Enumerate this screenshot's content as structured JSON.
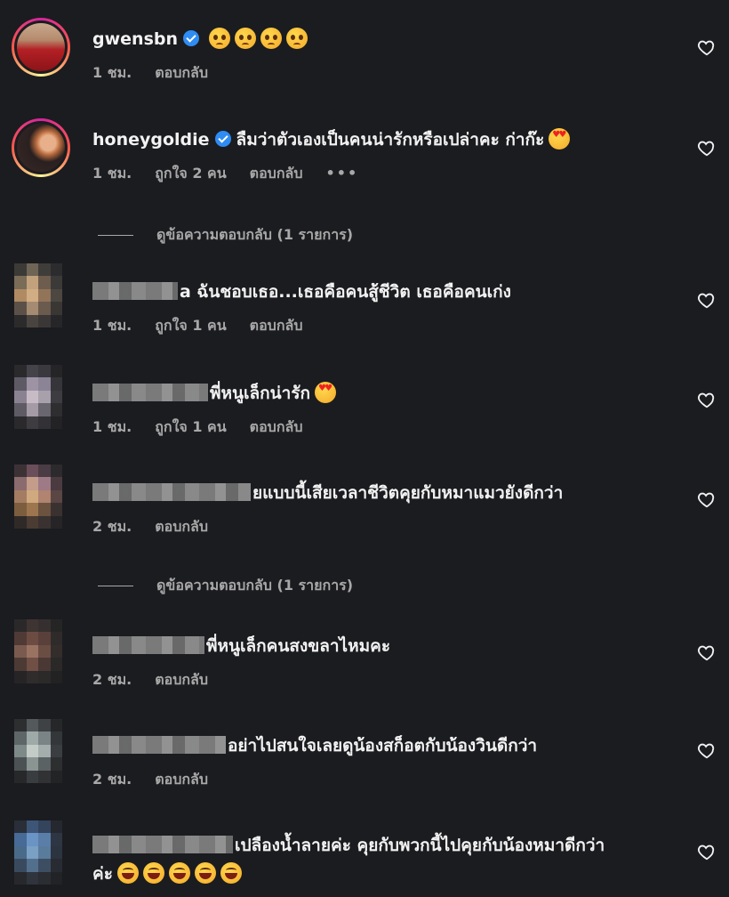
{
  "comments": [
    {
      "user": "gwensbn",
      "verified": true,
      "text": "",
      "emoji": [
        "plead",
        "plead",
        "plead",
        "plead"
      ],
      "time": "1 ชม.",
      "likes": "",
      "reply": "ตอบกลับ"
    },
    {
      "user": "honeygoldie",
      "verified": true,
      "text": "ลืมว่าตัวเองเป็นคนน่ารักหรือเปล่าคะ ก่าก๊ะ",
      "emoji": [
        "heart"
      ],
      "time": "1 ชม.",
      "likes": "ถูกใจ 2 คน",
      "reply": "ตอบกลับ",
      "more": "•••"
    },
    {
      "user": "",
      "text": "a ฉันชอบเธอ...เธอคือคนสู้ชีวิต เธอคือคนเก่ง",
      "time": "1 ชม.",
      "likes": "ถูกใจ 1 คน",
      "reply": "ตอบกลับ"
    },
    {
      "user": "",
      "text": "พี่หนูเล็กน่ารัก",
      "emoji": [
        "heart"
      ],
      "time": "1 ชม.",
      "likes": "ถูกใจ 1 คน",
      "reply": "ตอบกลับ"
    },
    {
      "user": "",
      "text": "ยแบบนี้เสียเวลาชีวิตคุยกับหมาแมวยังดีกว่า",
      "time": "2 ชม.",
      "likes": "",
      "reply": "ตอบกลับ"
    },
    {
      "user": "",
      "text": "พี่หนูเล็กคนสงขลาไหมคะ",
      "time": "2 ชม.",
      "likes": "",
      "reply": "ตอบกลับ"
    },
    {
      "user": "",
      "text": "อย่าไปสนใจเลยดูน้องสก็อตกับน้องวินดีกว่า",
      "time": "2 ชม.",
      "likes": "",
      "reply": "ตอบกลับ"
    },
    {
      "user": "",
      "text": "เปลืองน้ำลายค่ะ คุยกับพวกนี้ไปคุยกับน้องหมาดีกว่า",
      "text2": "ค่ะ",
      "emoji": [
        "laugh",
        "laugh",
        "laugh",
        "laugh",
        "laugh"
      ]
    }
  ],
  "view_replies": "ดูข้อความตอบกลับ (1 รายการ)",
  "colors": {
    "background": "#1b1c20",
    "verified": "#2f8cf2",
    "meta": "#a8a8a8"
  }
}
